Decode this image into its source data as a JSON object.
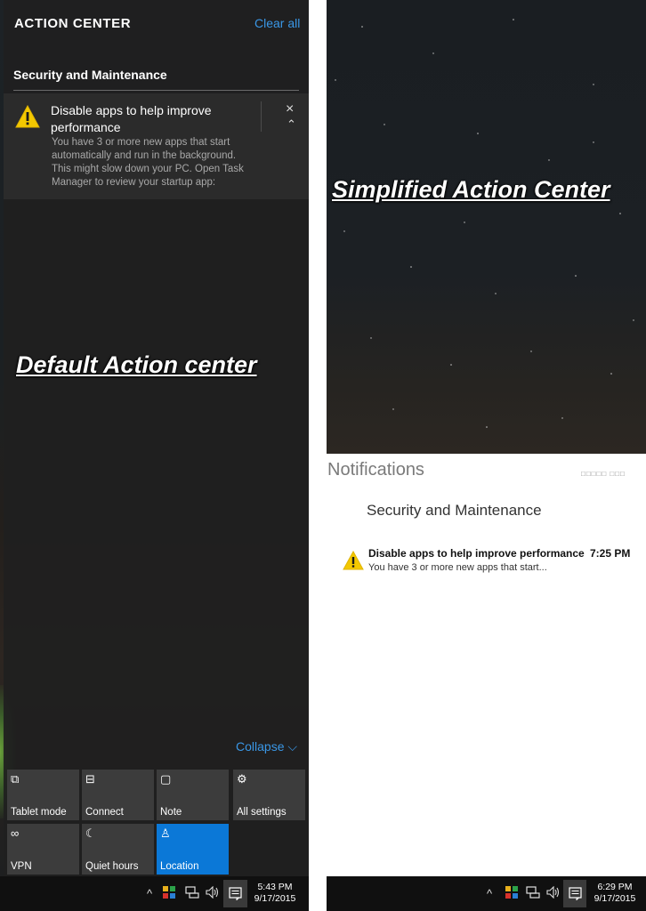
{
  "left_panel": {
    "header_title": "ACTION CENTER",
    "clear_all": "Clear all",
    "group_title": "Security and Maintenance",
    "notification": {
      "title": "Disable apps to help improve performance",
      "body": "You have 3 or more new apps that start automatically and run in the background. This might slow down your PC. Open Task Manager to review your startup app:",
      "close_glyph": "×",
      "collapse_glyph": "⌃"
    },
    "overlay_label": "Default Action center",
    "collapse": "Collapse ⌵",
    "quick_actions": [
      {
        "label": "Tablet mode",
        "icon": "tablet-mode-icon",
        "glyph": "⧉"
      },
      {
        "label": "Connect",
        "icon": "connect-icon",
        "glyph": "⊟"
      },
      {
        "label": "Note",
        "icon": "note-icon",
        "glyph": "▢"
      },
      {
        "label": "All settings",
        "icon": "gear-icon",
        "glyph": "⚙"
      },
      {
        "label": "VPN",
        "icon": "vpn-icon",
        "glyph": "∞"
      },
      {
        "label": "Quiet hours",
        "icon": "moon-icon",
        "glyph": "☾"
      },
      {
        "label": "Location",
        "icon": "location-icon",
        "glyph": "♙"
      }
    ],
    "taskbar": {
      "chevron": "^",
      "time": "5:43 PM",
      "date": "9/17/2015"
    }
  },
  "right_panel": {
    "overlay_label": "Simplified Action Center",
    "notifications_title": "Notifications",
    "notifications_status": "□□□□□ □□□",
    "group_title": "Security and Maintenance",
    "notification": {
      "title": "Disable apps to help improve performance",
      "time": "7:25 PM",
      "body": "You have 3 or more new apps that start..."
    },
    "taskbar": {
      "chevron": "^",
      "time": "6:29 PM",
      "date": "9/17/2015"
    }
  },
  "colors": {
    "accent_blue": "#0b78d7",
    "link_blue": "#3a97e6",
    "warning_yellow": "#f3c800"
  }
}
